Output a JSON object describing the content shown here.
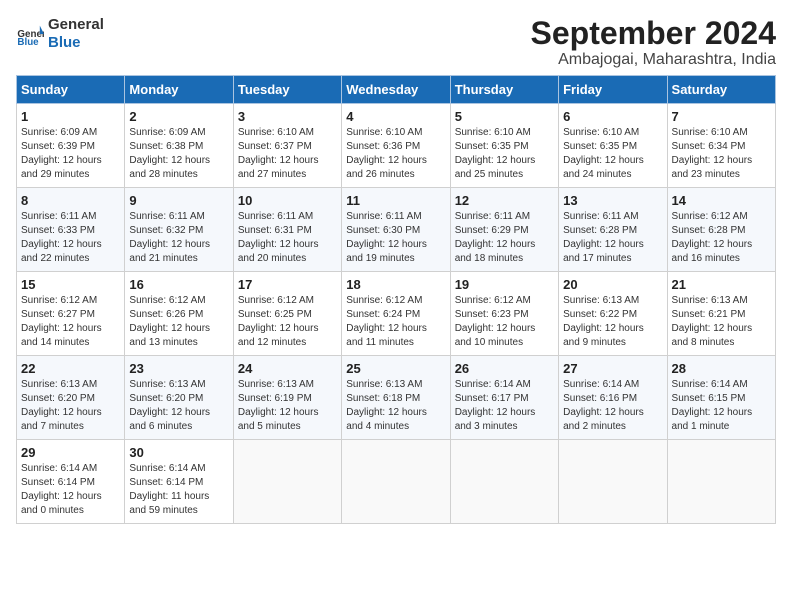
{
  "logo": {
    "general": "General",
    "blue": "Blue"
  },
  "title": "September 2024",
  "subtitle": "Ambajogai, Maharashtra, India",
  "days_of_week": [
    "Sunday",
    "Monday",
    "Tuesday",
    "Wednesday",
    "Thursday",
    "Friday",
    "Saturday"
  ],
  "weeks": [
    [
      {
        "day": "1",
        "sunrise": "6:09 AM",
        "sunset": "6:39 PM",
        "daylight": "12 hours and 29 minutes."
      },
      {
        "day": "2",
        "sunrise": "6:09 AM",
        "sunset": "6:38 PM",
        "daylight": "12 hours and 28 minutes."
      },
      {
        "day": "3",
        "sunrise": "6:10 AM",
        "sunset": "6:37 PM",
        "daylight": "12 hours and 27 minutes."
      },
      {
        "day": "4",
        "sunrise": "6:10 AM",
        "sunset": "6:36 PM",
        "daylight": "12 hours and 26 minutes."
      },
      {
        "day": "5",
        "sunrise": "6:10 AM",
        "sunset": "6:35 PM",
        "daylight": "12 hours and 25 minutes."
      },
      {
        "day": "6",
        "sunrise": "6:10 AM",
        "sunset": "6:35 PM",
        "daylight": "12 hours and 24 minutes."
      },
      {
        "day": "7",
        "sunrise": "6:10 AM",
        "sunset": "6:34 PM",
        "daylight": "12 hours and 23 minutes."
      }
    ],
    [
      {
        "day": "8",
        "sunrise": "6:11 AM",
        "sunset": "6:33 PM",
        "daylight": "12 hours and 22 minutes."
      },
      {
        "day": "9",
        "sunrise": "6:11 AM",
        "sunset": "6:32 PM",
        "daylight": "12 hours and 21 minutes."
      },
      {
        "day": "10",
        "sunrise": "6:11 AM",
        "sunset": "6:31 PM",
        "daylight": "12 hours and 20 minutes."
      },
      {
        "day": "11",
        "sunrise": "6:11 AM",
        "sunset": "6:30 PM",
        "daylight": "12 hours and 19 minutes."
      },
      {
        "day": "12",
        "sunrise": "6:11 AM",
        "sunset": "6:29 PM",
        "daylight": "12 hours and 18 minutes."
      },
      {
        "day": "13",
        "sunrise": "6:11 AM",
        "sunset": "6:28 PM",
        "daylight": "12 hours and 17 minutes."
      },
      {
        "day": "14",
        "sunrise": "6:12 AM",
        "sunset": "6:28 PM",
        "daylight": "12 hours and 16 minutes."
      }
    ],
    [
      {
        "day": "15",
        "sunrise": "6:12 AM",
        "sunset": "6:27 PM",
        "daylight": "12 hours and 14 minutes."
      },
      {
        "day": "16",
        "sunrise": "6:12 AM",
        "sunset": "6:26 PM",
        "daylight": "12 hours and 13 minutes."
      },
      {
        "day": "17",
        "sunrise": "6:12 AM",
        "sunset": "6:25 PM",
        "daylight": "12 hours and 12 minutes."
      },
      {
        "day": "18",
        "sunrise": "6:12 AM",
        "sunset": "6:24 PM",
        "daylight": "12 hours and 11 minutes."
      },
      {
        "day": "19",
        "sunrise": "6:12 AM",
        "sunset": "6:23 PM",
        "daylight": "12 hours and 10 minutes."
      },
      {
        "day": "20",
        "sunrise": "6:13 AM",
        "sunset": "6:22 PM",
        "daylight": "12 hours and 9 minutes."
      },
      {
        "day": "21",
        "sunrise": "6:13 AM",
        "sunset": "6:21 PM",
        "daylight": "12 hours and 8 minutes."
      }
    ],
    [
      {
        "day": "22",
        "sunrise": "6:13 AM",
        "sunset": "6:20 PM",
        "daylight": "12 hours and 7 minutes."
      },
      {
        "day": "23",
        "sunrise": "6:13 AM",
        "sunset": "6:20 PM",
        "daylight": "12 hours and 6 minutes."
      },
      {
        "day": "24",
        "sunrise": "6:13 AM",
        "sunset": "6:19 PM",
        "daylight": "12 hours and 5 minutes."
      },
      {
        "day": "25",
        "sunrise": "6:13 AM",
        "sunset": "6:18 PM",
        "daylight": "12 hours and 4 minutes."
      },
      {
        "day": "26",
        "sunrise": "6:14 AM",
        "sunset": "6:17 PM",
        "daylight": "12 hours and 3 minutes."
      },
      {
        "day": "27",
        "sunrise": "6:14 AM",
        "sunset": "6:16 PM",
        "daylight": "12 hours and 2 minutes."
      },
      {
        "day": "28",
        "sunrise": "6:14 AM",
        "sunset": "6:15 PM",
        "daylight": "12 hours and 1 minute."
      }
    ],
    [
      {
        "day": "29",
        "sunrise": "6:14 AM",
        "sunset": "6:14 PM",
        "daylight": "12 hours and 0 minutes."
      },
      {
        "day": "30",
        "sunrise": "6:14 AM",
        "sunset": "6:14 PM",
        "daylight": "11 hours and 59 minutes."
      },
      null,
      null,
      null,
      null,
      null
    ]
  ],
  "labels": {
    "sunrise": "Sunrise: ",
    "sunset": "Sunset: ",
    "daylight": "Daylight: "
  }
}
